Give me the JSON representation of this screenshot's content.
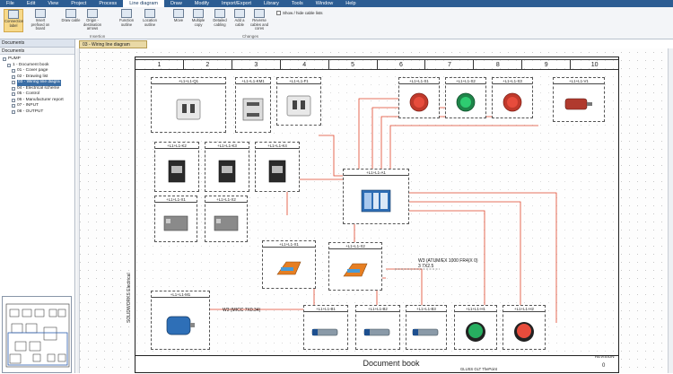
{
  "menu": [
    "File",
    "Edit",
    "View",
    "Project",
    "Process",
    "Line diagram",
    "Draw",
    "Modify",
    "Import/Export",
    "Library",
    "Tools",
    "Window",
    "Help"
  ],
  "menu_active": "Line diagram",
  "ribbon": {
    "buttons": [
      {
        "label": "Connection label"
      },
      {
        "label": "Insert prefixed on board"
      },
      {
        "label": "Draw cable"
      },
      {
        "label": "Origin - destination arrows"
      },
      {
        "label": "Function outline"
      },
      {
        "label": "Location outline"
      },
      {
        "label": "Move"
      },
      {
        "label": "Multiple copy"
      },
      {
        "label": "Detailed cabling"
      },
      {
        "label": "Add a cable"
      },
      {
        "label": "Reverse cables and cores"
      }
    ],
    "groups": [
      "Insertion",
      "Changes"
    ],
    "checkbox_label": "Show / hide cable lists"
  },
  "sidebar": {
    "header": "Documents",
    "tab": "Documents",
    "tree": [
      {
        "label": "PUMP",
        "level": 0,
        "selected": false
      },
      {
        "label": "1 - Document book",
        "level": 1,
        "selected": false
      },
      {
        "label": "01 - Cover page",
        "level": 2,
        "selected": false
      },
      {
        "label": "02 - Drawing list",
        "level": 2,
        "selected": false
      },
      {
        "label": "03 - Wiring line diagra",
        "level": 2,
        "selected": true
      },
      {
        "label": "04 - Electrical scheme",
        "level": 2,
        "selected": false
      },
      {
        "label": "05 - Control",
        "level": 2,
        "selected": false
      },
      {
        "label": "06 - Manufacturer report",
        "level": 2,
        "selected": false
      },
      {
        "label": "07 - INPUT",
        "level": 2,
        "selected": false
      },
      {
        "label": "08 - OUTPUT",
        "level": 2,
        "selected": false
      }
    ]
  },
  "document_tab": "03 - Wiring line diagram",
  "sheet": {
    "columns": [
      "1",
      "2",
      "3",
      "4",
      "5",
      "6",
      "7",
      "8",
      "9",
      "10"
    ]
  },
  "components": [
    {
      "id": "q1",
      "tag": "+L1+L1-Q1",
      "kind": "breaker"
    },
    {
      "id": "km1",
      "tag": "+L1+L1-KM1",
      "kind": "contactor"
    },
    {
      "id": "f1",
      "tag": "+L1+L1-F1",
      "kind": "breaker"
    },
    {
      "id": "s1",
      "tag": "+L1+L1-S1",
      "kind": "red-button"
    },
    {
      "id": "s2",
      "tag": "+L1+L1-S2",
      "kind": "green-button"
    },
    {
      "id": "s3",
      "tag": "+L1+L1-S3",
      "kind": "red-button"
    },
    {
      "id": "v1",
      "tag": "+L1+L1-V1",
      "kind": "motor-red"
    },
    {
      "id": "k2",
      "tag": "+L1+L1-K2",
      "kind": "relay"
    },
    {
      "id": "k3",
      "tag": "+L1+L1-K3",
      "kind": "relay"
    },
    {
      "id": "k4",
      "tag": "+L1+L1-K4",
      "kind": "relay"
    },
    {
      "id": "x1",
      "tag": "+L1+L1-X1",
      "kind": "block"
    },
    {
      "id": "x2",
      "tag": "+L1+L1-X2",
      "kind": "block"
    },
    {
      "id": "a1",
      "tag": "+L1+L1-A1",
      "kind": "plc"
    },
    {
      "id": "tx1",
      "tag": "+L1+L1-X1",
      "kind": "terminal"
    },
    {
      "id": "tx2",
      "tag": "+L1+L1-X2",
      "kind": "terminal"
    },
    {
      "id": "m1",
      "tag": "+L1+L1-M1",
      "kind": "motor"
    },
    {
      "id": "b1",
      "tag": "+L1+L1-B1",
      "kind": "sensor"
    },
    {
      "id": "b2",
      "tag": "+L1+L1-B2",
      "kind": "sensor"
    },
    {
      "id": "b3",
      "tag": "+L1+L1-B3",
      "kind": "sensor"
    },
    {
      "id": "h1",
      "tag": "+L1+L1-H1",
      "kind": "green-lamp"
    },
    {
      "id": "h2",
      "tag": "+L1+L1-H2",
      "kind": "red-lamp"
    }
  ],
  "wire_labels": {
    "main": "W3 (MICC 7X0.34)",
    "cable": "W3 (ATUM/EX 1000 FR4(X 0) 3 7X2.5"
  },
  "title_block": {
    "title": "Document book",
    "revision_label": "REVISION",
    "revision": "0",
    "small": "GLUSS GLT   ThePoint",
    "vertical": "SOLIDWORKS Electrical"
  }
}
